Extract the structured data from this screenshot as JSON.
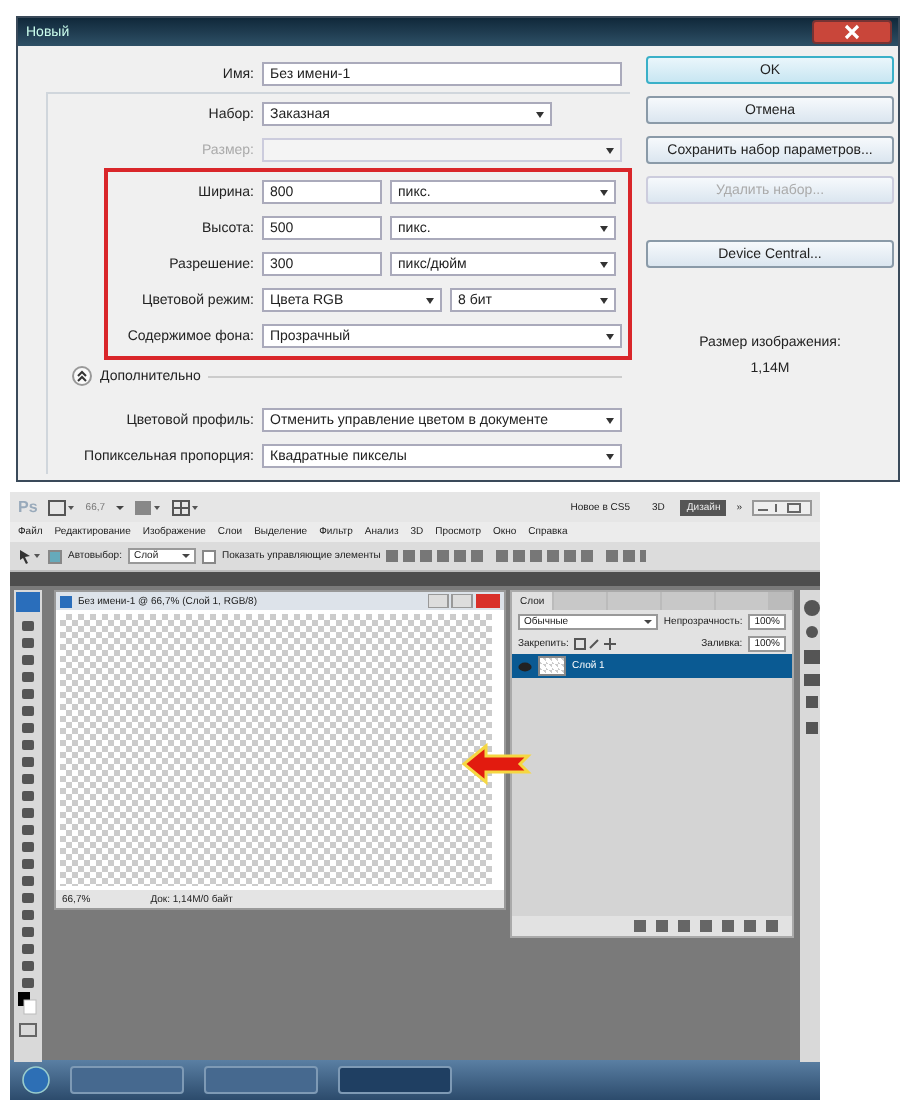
{
  "dialog": {
    "title": "Новый",
    "name": {
      "label": "Имя:",
      "value": "Без имени-1"
    },
    "preset": {
      "label": "Набор:",
      "value": "Заказная"
    },
    "size": {
      "label": "Размер:",
      "disabled": true
    },
    "fields": [
      {
        "label": "Ширина:",
        "value": "800",
        "unit": "пикс."
      },
      {
        "label": "Высота:",
        "value": "500",
        "unit": "пикс."
      },
      {
        "label": "Разрешение:",
        "value": "300",
        "unit": "пикс/дюйм"
      }
    ],
    "color_mode": {
      "label": "Цветовой режим:",
      "value": "Цвета RGB",
      "depth": "8 бит"
    },
    "background": {
      "label": "Содержимое фона:",
      "value": "Прозрачный"
    },
    "advanced": {
      "label": "Дополнительно",
      "expanded": true
    },
    "profile": {
      "label": "Цветовой профиль:",
      "value": "Отменить управление цветом в документе"
    },
    "aspect": {
      "label": "Попиксельная пропорция:",
      "value": "Квадратные пикселы"
    },
    "buttons": [
      {
        "label": "OK",
        "default": true,
        "disabled": false
      },
      {
        "label": "Отмена",
        "default": false,
        "disabled": false
      },
      {
        "label": "Сохранить набор параметров...",
        "default": false,
        "disabled": false
      },
      {
        "label": "Удалить набор...",
        "default": false,
        "disabled": true
      },
      {
        "label": "Device Central...",
        "default": false,
        "disabled": false
      }
    ],
    "image_size_label": "Размер изображения:",
    "image_size": "1,14M"
  },
  "photoshop": {
    "logo": "Ps",
    "zoom": "66,7",
    "workspaces": [
      {
        "label": "Новое в CS5",
        "selected": false
      },
      {
        "label": "3D",
        "selected": false
      },
      {
        "label": "Дизайн",
        "selected": true
      }
    ],
    "more": "»",
    "menu": [
      "Файл",
      "Редактирование",
      "Изображение",
      "Слои",
      "Выделение",
      "Фильтр",
      "Анализ",
      "3D",
      "Просмотр",
      "Окно",
      "Справка"
    ],
    "options": {
      "autoselect": {
        "label": "Автовыбор:",
        "checked": true
      },
      "target": "Слой",
      "show_controls": {
        "label": "Показать управляющие элементы",
        "checked": false
      }
    },
    "document": {
      "title": "Без имени-1 @ 66,7% (Слой 1, RGB/8)",
      "zoom": "66,7%",
      "info": "Док: 1,14M/0 байт"
    },
    "layers_panel": {
      "tabs": [
        {
          "label": "Слои",
          "selected": true
        }
      ],
      "blend_mode": "Обычные",
      "opacity_label": "Непрозрачность:",
      "opacity": "100%",
      "lock_label": "Закрепить:",
      "fill_label": "Заливка:",
      "fill": "100%",
      "layers": [
        {
          "name": "Слой 1",
          "selected": true,
          "visible": true
        }
      ]
    }
  }
}
